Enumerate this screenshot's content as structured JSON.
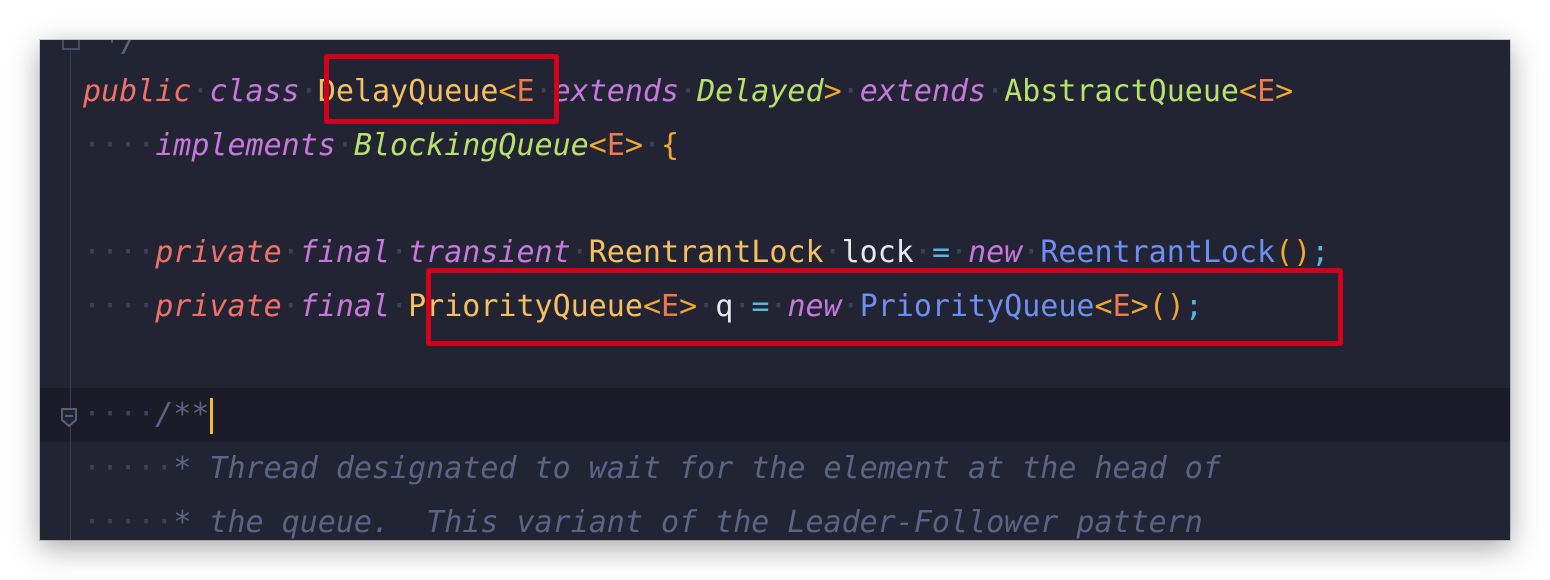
{
  "editor": {
    "line0": {
      "whitespace": "",
      "text": "*/"
    },
    "line1": {
      "kw_public": "public",
      "kw_class": "class",
      "class_name": "DelayQueue",
      "lt1": "<",
      "type_param": "E",
      "kw_extends1": "extends",
      "bound": "Delayed",
      "gt1": ">",
      "kw_extends2": "extends",
      "super": "AbstractQueue",
      "lt2": "<",
      "super_param": "E",
      "gt2": ">"
    },
    "line2": {
      "indent": "····",
      "kw_implements": "implements",
      "iface": "BlockingQueue",
      "lt": "<",
      "param": "E",
      "gt": ">",
      "brace": "{"
    },
    "line3": {
      "indent": "····",
      "kw_private": "private",
      "kw_final": "final",
      "kw_transient": "transient",
      "type": "ReentrantLock",
      "var": "lock",
      "eq": "=",
      "kw_new": "new",
      "ctor": "ReentrantLock",
      "paren_open": "(",
      "paren_close": ")",
      "semi": ";"
    },
    "line4": {
      "indent": "····",
      "kw_private": "private",
      "kw_final": "final",
      "type": "PriorityQueue",
      "lt1": "<",
      "param1": "E",
      "gt1": ">",
      "var": "q",
      "eq": "=",
      "kw_new": "new",
      "ctor": "PriorityQueue",
      "lt2": "<",
      "param2": "E",
      "gt2": ">",
      "parens": "()",
      "semi": ";"
    },
    "line5": {
      "indent": "····",
      "text": "/**"
    },
    "line6": {
      "indent": "·····",
      "text": "* Thread designated to wait for the element at the head of"
    },
    "line7": {
      "indent": "·····",
      "text": "* the queue.  This variant of the Leader-Follower pattern"
    }
  },
  "colors": {
    "background": "#232433",
    "highlight_box": "#d0021b",
    "caret": "#f5b63b"
  },
  "icons": [
    "fold-marker-icon"
  ]
}
